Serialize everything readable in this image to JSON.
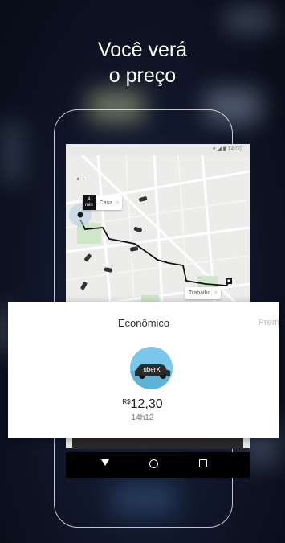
{
  "headline": {
    "line1": "Você verá",
    "line2": "o preço"
  },
  "status_bar": {
    "time": "14:00"
  },
  "map": {
    "eta_value": "4",
    "eta_unit": "min",
    "origin_label": "Casa",
    "destination_label": "Trabalho",
    "chevron": ">"
  },
  "fare_card": {
    "category": "Econômico",
    "next_category_partial": "Prem",
    "product_name": "uberX",
    "currency": "R$",
    "price": "12,30",
    "arrival_time": "14h12"
  },
  "colors": {
    "accent_blue": "#79c7e9",
    "background": "#0e1424"
  },
  "icons": [
    "back-arrow-icon",
    "wifi-icon",
    "signal-icon",
    "battery-icon",
    "car-icon",
    "nav-back-icon",
    "nav-home-icon",
    "nav-recent-icon"
  ]
}
